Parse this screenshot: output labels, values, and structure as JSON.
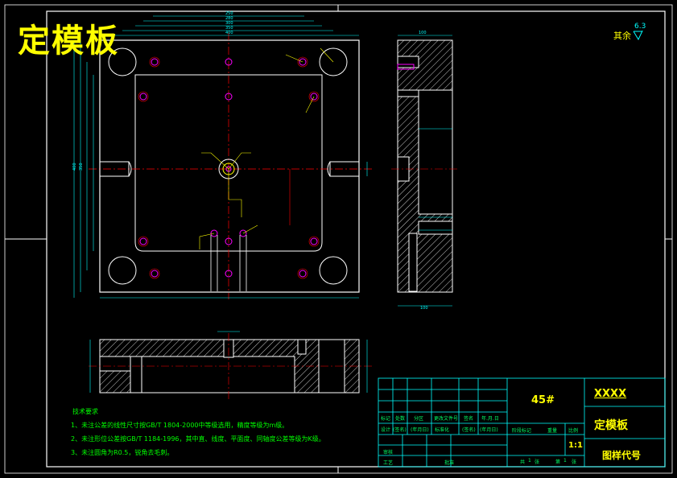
{
  "drawing": {
    "title": "定模板",
    "roughness": {
      "label": "其余",
      "value": "6.3"
    },
    "notes": {
      "heading": "技术要求",
      "items": [
        "1、未注公差的线性尺寸按GB/T 1804-2000中等级选用，精度等级为m级。",
        "2、未注形位公差按GB/T 1184-1996，其中直、线度、平面度、同轴度公差等级为K级。",
        "3、未注圆角为R0.5，锐角去毛刺。"
      ]
    }
  },
  "title_block": {
    "material": "45#",
    "company": "XXXX",
    "part_name": "定模板",
    "drawing_no_label": "图样代号",
    "scale": "1:1",
    "row_labels": [
      "标记",
      "处数",
      "分区",
      "更改文件号",
      "签名",
      "年.月.日"
    ],
    "row_values": [
      "(签名)",
      "(年月日)",
      "标准化",
      "(签名)",
      "(年月日)"
    ],
    "design": "设计",
    "review": "审核",
    "process": "工艺",
    "approve": "批准",
    "stage_labels": [
      "阶段标记",
      "重量",
      "比例"
    ],
    "sheets": [
      "共",
      "1",
      "张",
      "第",
      "1",
      "张"
    ]
  },
  "colors": {
    "background": "#000000",
    "outline": "#ffffff",
    "dimension": "#00ffff",
    "center": "#ff0000",
    "hatch": "#ffffff",
    "hole": "#ff00ff",
    "annotation": "#ffff00",
    "text": "#00ff00"
  }
}
